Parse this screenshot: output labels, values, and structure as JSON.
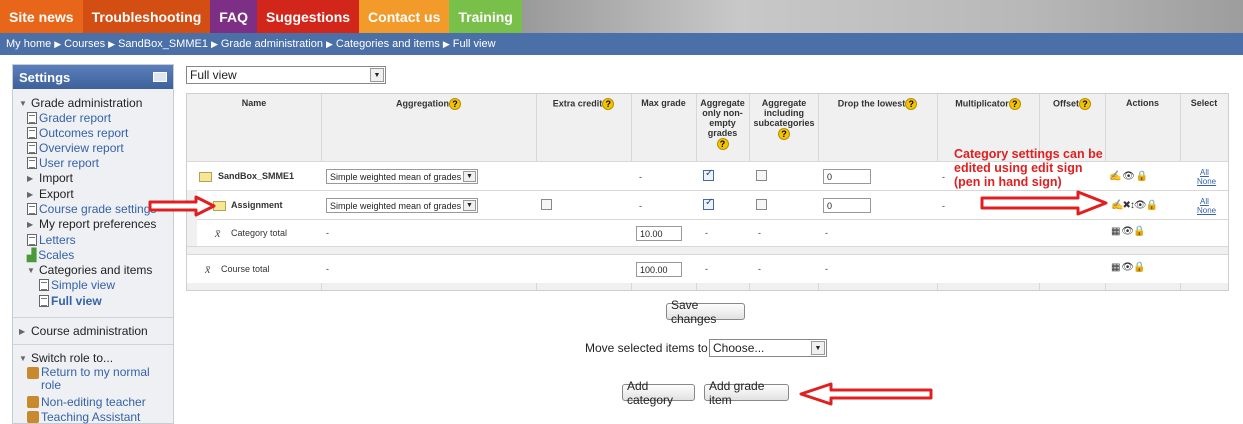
{
  "topnav": {
    "tabs": [
      {
        "label": "Site news",
        "color": "#e8661a"
      },
      {
        "label": "Troubleshooting",
        "color": "#d24e13"
      },
      {
        "label": "FAQ",
        "color": "#7d2f86"
      },
      {
        "label": "Suggestions",
        "color": "#d2261b"
      },
      {
        "label": "Contact us",
        "color": "#f29a2a"
      },
      {
        "label": "Training",
        "color": "#78c04a"
      }
    ]
  },
  "breadcrumb": [
    "My home",
    "Courses",
    "SandBox_SMME1",
    "Grade administration",
    "Categories and items",
    "Full view"
  ],
  "sidebar": {
    "title": "Settings",
    "grade_admin": "Grade administration",
    "links": [
      "Grader report",
      "Outcomes report",
      "Overview report",
      "User report"
    ],
    "import": "Import",
    "export": "Export",
    "course_grade_settings": "Course grade settings",
    "my_report_prefs": "My report preferences",
    "letters": "Letters",
    "scales": "Scales",
    "categories_items": "Categories and items",
    "simple_view": "Simple view",
    "full_view": "Full view",
    "course_admin": "Course administration",
    "switch_role": "Switch role to...",
    "return_role": "Return to my normal role",
    "non_editing": "Non-editing teacher",
    "teaching_assistant": "Teaching Assistant"
  },
  "view_select": {
    "value": "Full view"
  },
  "table": {
    "headers": {
      "name": "Name",
      "aggregation": "Aggregation",
      "extra_credit": "Extra credit",
      "max_grade": "Max grade",
      "agg_nonempty": "Aggregate only non-empty grades",
      "agg_subcats": "Aggregate including subcategories",
      "drop_lowest": "Drop the lowest",
      "multiplicator": "Multiplicator",
      "offset": "Offset",
      "actions": "Actions",
      "select": "Select"
    },
    "rows": {
      "sandbox": {
        "name": "SandBox_SMME1",
        "aggregation": "Simple weighted mean of grades",
        "max_grade": "-",
        "drop_lowest": "0",
        "multiplicator": "-",
        "select_all": "All",
        "select_none": "None"
      },
      "assignment": {
        "name": "Assignment",
        "aggregation": "Simple weighted mean of grades",
        "max_grade": "-",
        "drop_lowest": "0",
        "multiplicator": "-",
        "select_all": "All",
        "select_none": "None"
      },
      "category_total": {
        "name": "Category total",
        "aggregation": "-",
        "max_grade": "10.00",
        "agg_nonempty": "-",
        "agg_subcats": "-",
        "drop_lowest": "-"
      },
      "course_total": {
        "name": "Course total",
        "aggregation": "-",
        "max_grade": "100.00",
        "agg_nonempty": "-",
        "agg_subcats": "-",
        "drop_lowest": "-"
      }
    }
  },
  "buttons": {
    "save": "Save changes",
    "move_label": "Move selected items to",
    "move_value": "Choose...",
    "add_category": "Add category",
    "add_grade_item": "Add grade item"
  },
  "annotation": {
    "line1": "Category settings can be",
    "line2": "edited using edit sign",
    "line3": "(pen in hand sign)",
    "color": "#e02020"
  }
}
